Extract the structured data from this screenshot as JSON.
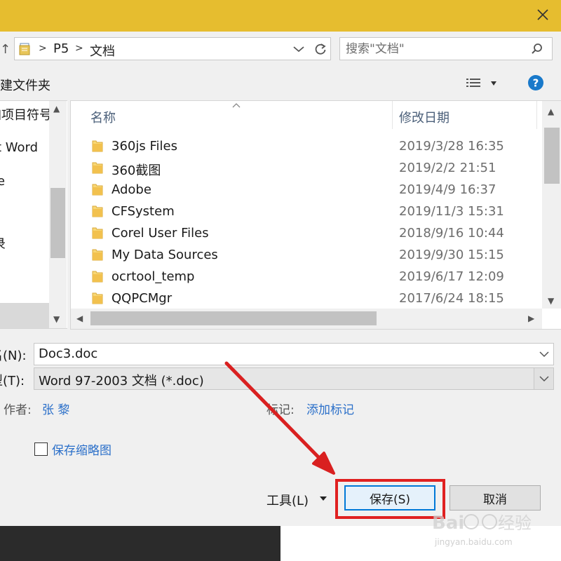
{
  "address": {
    "crumbs": [
      "P5",
      "文档"
    ]
  },
  "search": {
    "placeholder": "搜索\"文档\""
  },
  "toolbar": {
    "new_folder": "新建文件夹"
  },
  "nav": {
    "items": [
      "加项目符号",
      "ft Word",
      "e",
      "",
      "录"
    ]
  },
  "file_list": {
    "columns": {
      "name": "名称",
      "modified": "修改日期"
    },
    "rows": [
      {
        "name": "360js Files",
        "date": "2019/3/28 16:35"
      },
      {
        "name": "360截图",
        "date": "2019/2/2 21:51"
      },
      {
        "name": "Adobe",
        "date": "2019/4/9 16:37"
      },
      {
        "name": "CFSystem",
        "date": "2019/11/3 15:31"
      },
      {
        "name": "Corel User Files",
        "date": "2018/9/16 10:44"
      },
      {
        "name": "My Data Sources",
        "date": "2019/9/30 15:15"
      },
      {
        "name": "ocrtool_temp",
        "date": "2019/6/17 12:09"
      },
      {
        "name": "QQPCMgr",
        "date": "2017/6/24 18:15"
      }
    ]
  },
  "form": {
    "filename_label": "名(N):",
    "filename_value": "Doc3.doc",
    "filetype_label": "型(T):",
    "filetype_value": "Word 97-2003 文档 (*.doc)",
    "author_label": "作者:",
    "author_value": "张 黎",
    "tags_label": "标记:",
    "tags_value": "添加标记",
    "thumbnail_label": "保存缩略图"
  },
  "buttons": {
    "tools": "工具(L)",
    "save": "保存(S)",
    "cancel": "取消"
  },
  "watermark": {
    "text": "jingyan.baidu.com"
  },
  "colors": {
    "titlebar": "#e6bd2f",
    "highlight": "#e02020",
    "link": "#2a6fc9"
  }
}
